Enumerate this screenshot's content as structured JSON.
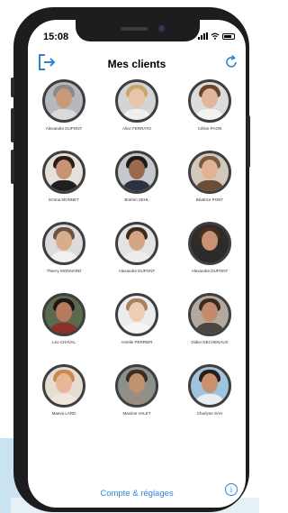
{
  "status_bar": {
    "time": "15:08"
  },
  "header": {
    "title": "Mes clients",
    "logout_icon": "logout-icon",
    "refresh_icon": "refresh-icon"
  },
  "clients": [
    {
      "name": "Alexandre DUPONT",
      "skin": "#c99a7a",
      "hair": "#8a8a8a",
      "shirt": "#d9d9d9",
      "bg": "#b5b8bd"
    },
    {
      "name": "Alice FERRATO",
      "skin": "#e8c4a8",
      "hair": "#c9a56b",
      "shirt": "#efefef",
      "bg": "#d4d4d4"
    },
    {
      "name": "Céline PAON",
      "skin": "#e0b79a",
      "hair": "#6b4529",
      "shirt": "#f2f2f2",
      "bg": "#dcdcdc"
    },
    {
      "name": "Emma MONNET",
      "skin": "#c79376",
      "hair": "#2c1e16",
      "shirt": "#1f1f1f",
      "bg": "#e5e0da"
    },
    {
      "name": "Brahim SEHL",
      "skin": "#9a6a4f",
      "hair": "#1a1a1a",
      "shirt": "#2b3340",
      "bg": "#c5c8cc"
    },
    {
      "name": "Béatrice PONT",
      "skin": "#e1b393",
      "hair": "#7b5b3e",
      "shirt": "#6b4e37",
      "bg": "#d2c8bc"
    },
    {
      "name": "Thierry MONNARD",
      "skin": "#d9ac8d",
      "hair": "#6a5242",
      "shirt": "#f0f0f0",
      "bg": "#dcdcdc"
    },
    {
      "name": "Alexandre DUPONT",
      "skin": "#d4a585",
      "hair": "#3d2b20",
      "shirt": "#ededed",
      "bg": "#e3e3e3"
    },
    {
      "name": "Alexandre DUPONT",
      "skin": "#c99272",
      "hair": "#4a2d1f",
      "shirt": "#2a2a2a",
      "bg": "#2e2b2b"
    },
    {
      "name": "Léo CHAVAL",
      "skin": "#b47c5c",
      "hair": "#1e1612",
      "shirt": "#8b2f2a",
      "bg": "#5a6a4f"
    },
    {
      "name": "Amélie PERRIER",
      "skin": "#edcdb4",
      "hair": "#a8825e",
      "shirt": "#f5f5f5",
      "bg": "#ececec"
    },
    {
      "name": "Didier DECHENAUX",
      "skin": "#c28c6c",
      "hair": "#3b2a1f",
      "shirt": "#4a4540",
      "bg": "#b4a99e"
    },
    {
      "name": "Maeva LARD",
      "skin": "#e8b896",
      "hair": "#c98a4f",
      "shirt": "#f0e6dc",
      "bg": "#e6ddd2"
    },
    {
      "name": "Maxime VALET",
      "skin": "#c0916f",
      "hair": "#3c2c22",
      "shirt": "#9b8e80",
      "bg": "#8c8f8a"
    },
    {
      "name": "Charlyne SAH",
      "skin": "#c8906c",
      "hair": "#2b1c14",
      "shirt": "#e8eef2",
      "bg": "#9ec5dd"
    }
  ],
  "footer": {
    "settings_label": "Compte & réglages",
    "info_label": "i"
  }
}
